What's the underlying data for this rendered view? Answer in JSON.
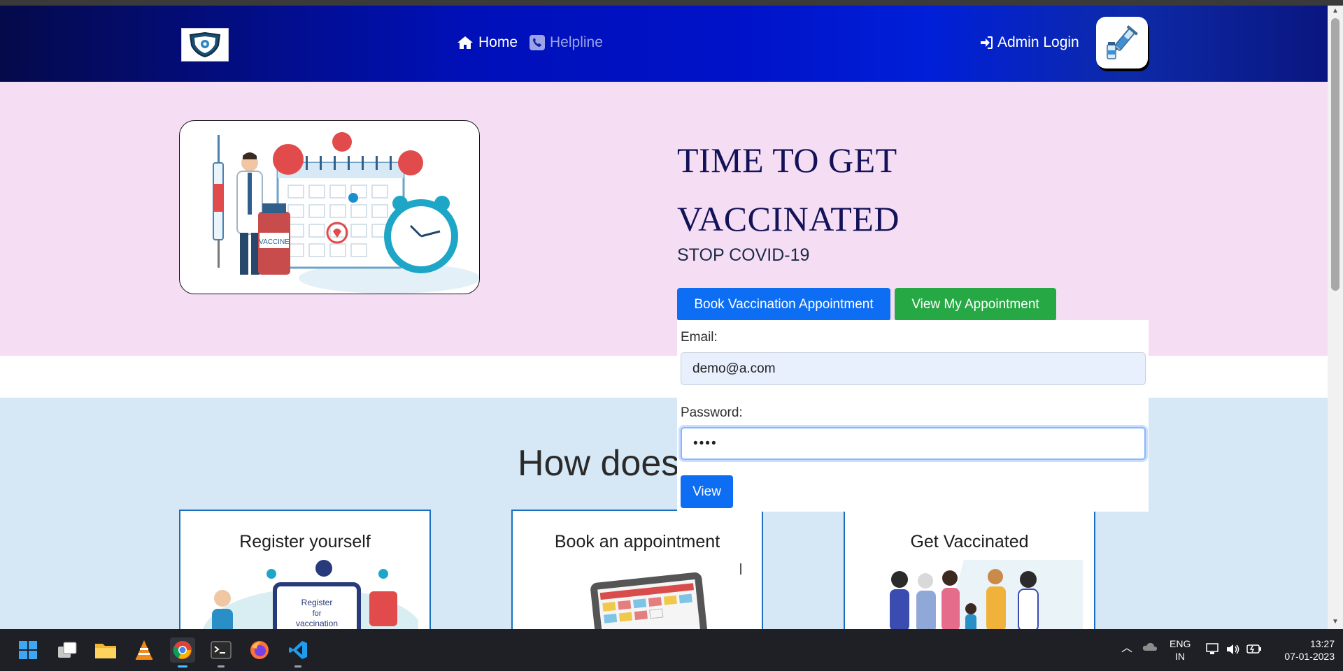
{
  "nav": {
    "home": "Home",
    "helpline": "Helpline",
    "admin_login": "Admin Login"
  },
  "hero": {
    "title": "TIME TO GET VACCINATED",
    "subtitle": "STOP COVID-19",
    "book_button": "Book Vaccination Appointment",
    "view_button": "View My Appointment"
  },
  "login_form": {
    "email_label": "Email:",
    "email_value": "demo@a.com",
    "password_label": "Password:",
    "password_value": "••••",
    "submit": "View"
  },
  "how": {
    "title": "How does",
    "steps": [
      {
        "title": "Register yourself"
      },
      {
        "title": "Book an appointment"
      },
      {
        "title": "Get Vaccinated"
      }
    ]
  },
  "taskbar": {
    "lang_top": "ENG",
    "lang_bottom": "IN",
    "time": "13:27",
    "date": "07-01-2023",
    "apps": [
      "windows-start-icon",
      "task-view-icon",
      "file-explorer-icon",
      "vlc-icon",
      "chrome-icon",
      "terminal-icon",
      "firefox-icon",
      "vscode-icon"
    ]
  },
  "colors": {
    "hero_bg": "#f5def4",
    "how_bg": "#d6e7f5",
    "primary": "#0d6ef3",
    "success": "#26a844",
    "title": "#131259"
  }
}
